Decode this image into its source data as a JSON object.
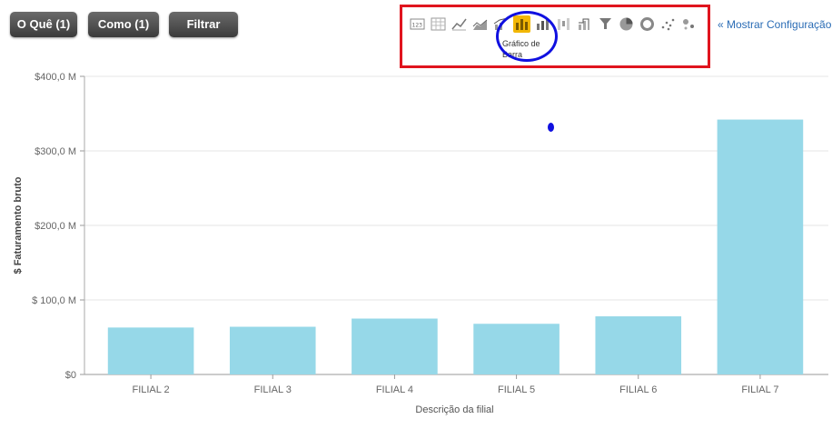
{
  "toolbar": {
    "what_label": "O Quê (1)",
    "how_label": "Como (1)",
    "filter_label": "Filtrar"
  },
  "chart_types": {
    "icons": [
      "number-icon",
      "table-icon",
      "line-icon",
      "area-icon",
      "combo-icon",
      "bar-chart-icon",
      "stacked-bar-icon",
      "waterfall-icon",
      "pareto-icon",
      "funnel-icon",
      "pie-icon",
      "donut-icon",
      "scatter-icon",
      "bubble-icon"
    ],
    "selected_index": 5,
    "tooltip": "Gráfico de Barra",
    "accent_color": "#f2b705"
  },
  "config_link": "« Mostrar Configuração",
  "annotations": {
    "red_box_color": "#e0141e",
    "blue_circle_color": "#1010e0"
  },
  "chart_data": {
    "type": "bar",
    "categories": [
      "FILIAL 2",
      "FILIAL 3",
      "FILIAL 4",
      "FILIAL 5",
      "FILIAL 6",
      "FILIAL 7"
    ],
    "values": [
      63,
      64,
      75,
      68,
      78,
      342
    ],
    "ylim": [
      0,
      400
    ],
    "yticks": [
      0,
      100,
      200,
      300,
      400
    ],
    "ytick_labels": [
      "$0",
      "$ 100,0 M",
      "$200,0 M",
      "$300,0 M",
      "$400,0 M"
    ],
    "xlabel": "Descrição da filial",
    "ylabel": "$ Faturamento bruto",
    "bar_color": "#96d8e8",
    "grid": true
  }
}
